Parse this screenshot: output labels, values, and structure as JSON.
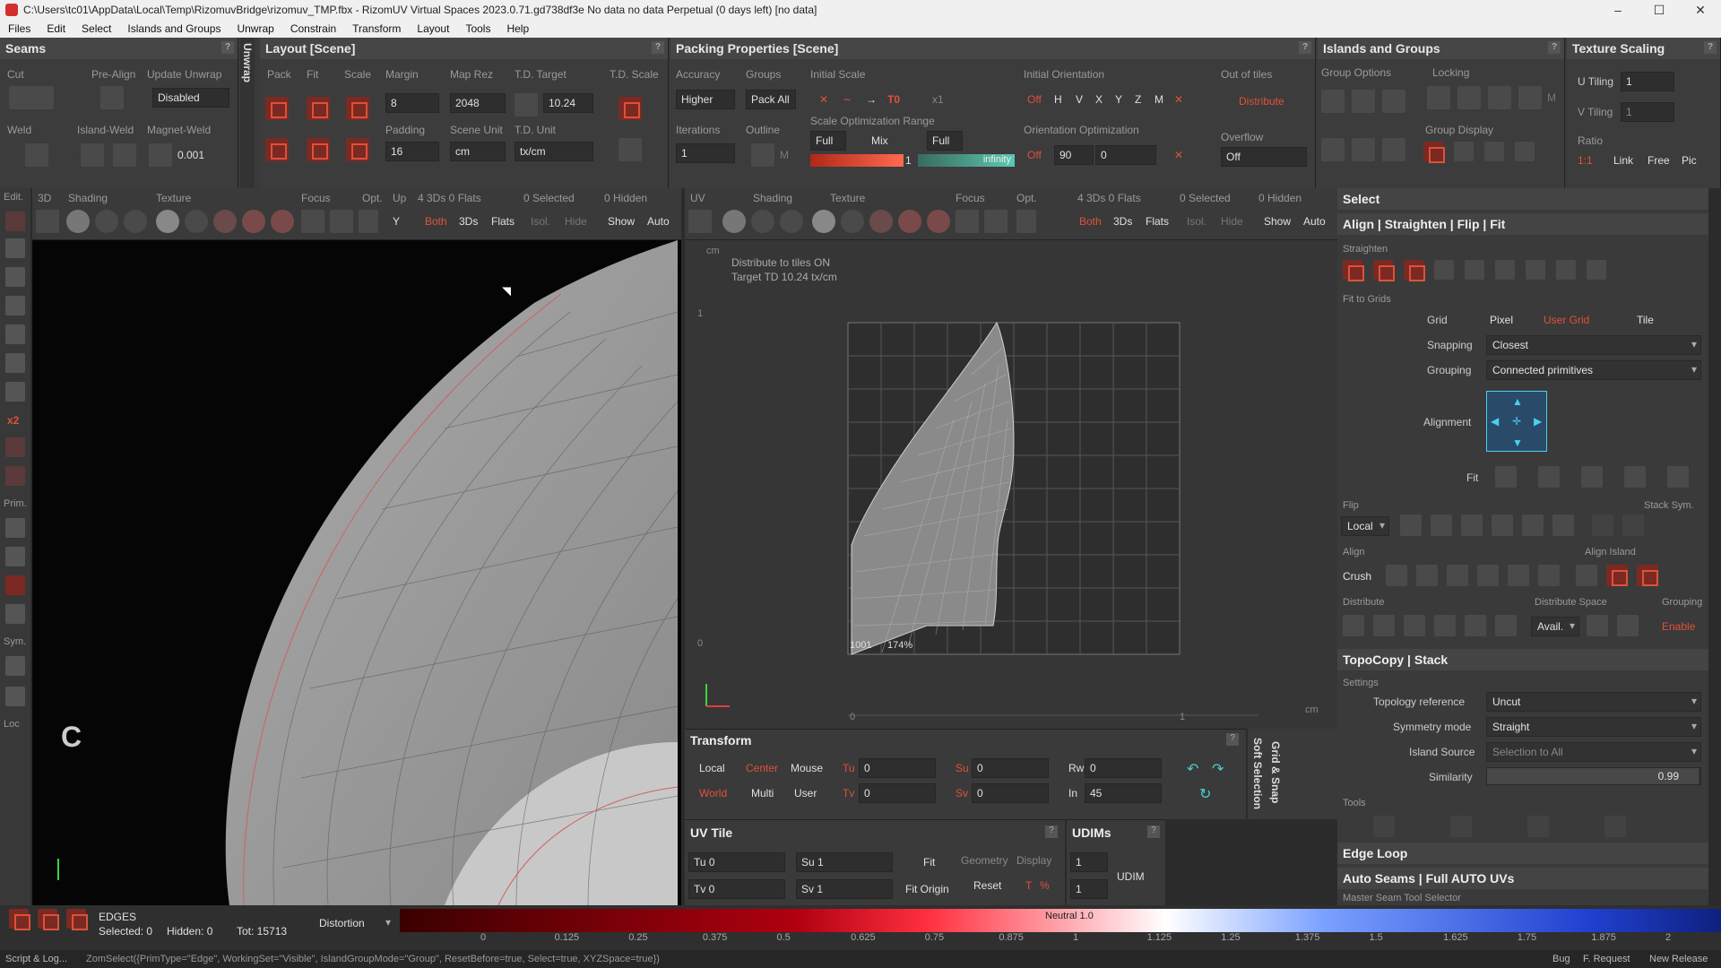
{
  "window": {
    "title": "C:\\Users\\tc01\\AppData\\Local\\Temp\\RizomuvBridge\\rizomuv_TMP.fbx - RizomUV  Virtual Spaces 2023.0.71.gd738df3e No data no data Perpetual  (0 days left) [no data]",
    "min": "–",
    "max": "☐",
    "close": "✕"
  },
  "menu": [
    "Files",
    "Edit",
    "Select",
    "Islands and Groups",
    "Unwrap",
    "Constrain",
    "Transform",
    "Layout",
    "Tools",
    "Help"
  ],
  "seams": {
    "title": "Seams",
    "cut": "Cut",
    "pre_align": "Pre-Align",
    "update_unwrap": "Update Unwrap",
    "update_value": "Disabled",
    "weld": "Weld",
    "island_weld": "Island-Weld",
    "magnet_weld": "Magnet-Weld",
    "magnet_value": "0.001",
    "unwrap_tab": "Unwrap"
  },
  "layout": {
    "title": "Layout [Scene]",
    "pack": "Pack",
    "fit": "Fit",
    "scale": "Scale",
    "margin": "Margin",
    "margin_value": "8",
    "map_rez": "Map Rez",
    "map_rez_value": "2048",
    "td_target": "T.D. Target",
    "td_target_value": "10.24",
    "td_scale": "T.D. Scale",
    "padding": "Padding",
    "padding_value": "16",
    "scene_unit": "Scene Unit",
    "scene_unit_value": "cm",
    "td_unit": "T.D. Unit",
    "td_unit_value": "tx/cm"
  },
  "packing": {
    "title": "Packing Properties [Scene]",
    "accuracy": "Accuracy",
    "accuracy_value": "Higher",
    "groups": "Groups",
    "pack_all": "Pack All",
    "initial_scale": "Initial Scale",
    "x1": "x1",
    "to": "T0",
    "initial_orientation": "Initial Orientation",
    "off": "Off",
    "h": "H",
    "v": "V",
    "x": "X",
    "y": "Y",
    "z": "Z",
    "m": "M",
    "out_of_tiles": "Out of tiles",
    "distribute": "Distribute",
    "iterations": "Iterations",
    "iterations_value": "1",
    "outline": "Outline",
    "outline_m": "M",
    "scale_opt_range": "Scale Optimization Range",
    "full": "Full",
    "mix": "Mix",
    "full2": "Full",
    "range_min": "1",
    "range_max": "infinity",
    "orientation_opt": "Orientation Optimization",
    "off2": "Off",
    "step": "90",
    "step2": "0",
    "overflow": "Overflow",
    "overflow_value": "Off"
  },
  "islands_groups": {
    "title": "Islands and Groups",
    "group_options": "Group Options",
    "locking": "Locking",
    "group_display": "Group Display",
    "m": "M"
  },
  "texture_scaling": {
    "title": "Texture Scaling",
    "u_tiling": "U Tiling",
    "u_value": "1",
    "v_tiling": "V Tiling",
    "v_value": "1",
    "ratio": "Ratio",
    "r11": "1:1",
    "link": "Link",
    "free": "Free",
    "pic": "Pic"
  },
  "view3d_bar": {
    "edit": "Edit.",
    "d3": "3D",
    "shading": "Shading",
    "texture": "Texture",
    "focus": "Focus",
    "opt": "Opt.",
    "up": "Up",
    "counts": "4 3Ds 0 Flats",
    "selected": "0 Selected",
    "hidden": "0 Hidden",
    "up_value": "Y",
    "both": "Both",
    "d3s": "3Ds",
    "flats": "Flats",
    "isol": "Isol.",
    "hide": "Hide",
    "show": "Show",
    "auto": "Auto"
  },
  "uv_bar": {
    "uv": "UV",
    "shading": "Shading",
    "texture": "Texture",
    "focus": "Focus",
    "opt": "Opt.",
    "counts": "4 3Ds 0 Flats",
    "selected": "0 Selected",
    "hidden": "0 Hidden",
    "both": "Both",
    "d3s": "3Ds",
    "flats": "Flats",
    "isol": "Isol.",
    "hide": "Hide",
    "show": "Show",
    "auto": "Auto"
  },
  "left_tools": {
    "x2": "x2",
    "prim": "Prim.",
    "sym": "Sym.",
    "loc": "Loc"
  },
  "viewport3d": {
    "letter": "C"
  },
  "uvview": {
    "unit": "cm",
    "info1": "Distribute to tiles  ON",
    "info2": "Target TD  10.24 tx/cm",
    "tile_label": "1001",
    "zoom": "174%",
    "axis_zero": "0",
    "axis_one": "1",
    "axis_cm": "cm",
    "y_one": "1",
    "y_zero": "0"
  },
  "select_panel": {
    "title": "Select",
    "align_title": "Align | Straighten | Flip | Fit",
    "straighten": "Straighten",
    "fit_to_grids": "Fit to Grids",
    "grid": "Grid",
    "pixel": "Pixel",
    "user_grid": "User Grid",
    "tile": "Tile",
    "snapping": "Snapping",
    "snapping_value": "Closest",
    "grouping": "Grouping",
    "grouping_value": "Connected primitives",
    "alignment": "Alignment",
    "fit": "Fit",
    "flip": "Flip",
    "stack_sym": "Stack Sym.",
    "local": "Local",
    "align": "Align",
    "align_island": "Align Island",
    "crush": "Crush",
    "distribute": "Distribute",
    "distribute_space": "Distribute Space",
    "grouping2": "Grouping",
    "avail": "Avail.",
    "enable": "Enable"
  },
  "topocopy": {
    "title": "TopoCopy | Stack",
    "settings": "Settings",
    "topology_reference": "Topology reference",
    "topology_value": "Uncut",
    "symmetry_mode": "Symmetry mode",
    "symmetry_value": "Straight",
    "island_source": "Island Source",
    "island_value": "Selection to All",
    "similarity": "Similarity",
    "similarity_value": "0.99",
    "tools": "Tools"
  },
  "edge_loop": {
    "title": "Edge Loop"
  },
  "auto_seams": {
    "title": "Auto Seams | Full AUTO UVs",
    "sub": "Master Seam Tool Selector"
  },
  "transform": {
    "title": "Transform",
    "local": "Local",
    "center": "Center",
    "mouse": "Mouse",
    "world": "World",
    "multi": "Multi",
    "user": "User",
    "tu": "Tu",
    "tu_value": "0",
    "tv": "Tv",
    "tv_value": "0",
    "su": "Su",
    "su_value": "0",
    "sv": "Sv",
    "sv_value": "0",
    "rw": "Rw",
    "rw_value": "0",
    "in": "In",
    "in_value": "45",
    "soft_selection": "Soft Selection",
    "grid_snap": "Grid & Snap"
  },
  "uvtile": {
    "title": "UV Tile",
    "tu": "Tu 0",
    "tv": "Tv 0",
    "su": "Su 1",
    "sv": "Sv 1",
    "fit": "Fit",
    "fit_origin": "Fit Origin",
    "geometry": "Geometry",
    "display": "Display",
    "reset": "Reset",
    "t": "T",
    "pct": "%"
  },
  "udims": {
    "title": "UDIMs",
    "v1": "1",
    "v2": "1",
    "udim": "UDIM"
  },
  "status": {
    "mode": "EDGES",
    "selected": "Selected: 0",
    "hidden": "Hidden: 0",
    "total": "Tot: 15713",
    "distortion": "Distortion",
    "neutral": "Neutral 1.0",
    "ticks": [
      "0",
      "0.125",
      "0.25",
      "0.375",
      "0.5",
      "0.625",
      "0.75",
      "0.875",
      "1",
      "1.125",
      "1.25",
      "1.375",
      "1.5",
      "1.625",
      "1.75",
      "1.875",
      "2"
    ]
  },
  "bottom": {
    "script": "Script & Log...",
    "command": "ZomSelect({PrimType=\"Edge\", WorkingSet=\"Visible\", IslandGroupMode=\"Group\", ResetBefore=true, Select=true, XYZSpace=true})",
    "bug": "Bug",
    "request": "F. Request",
    "release": "New Release"
  }
}
